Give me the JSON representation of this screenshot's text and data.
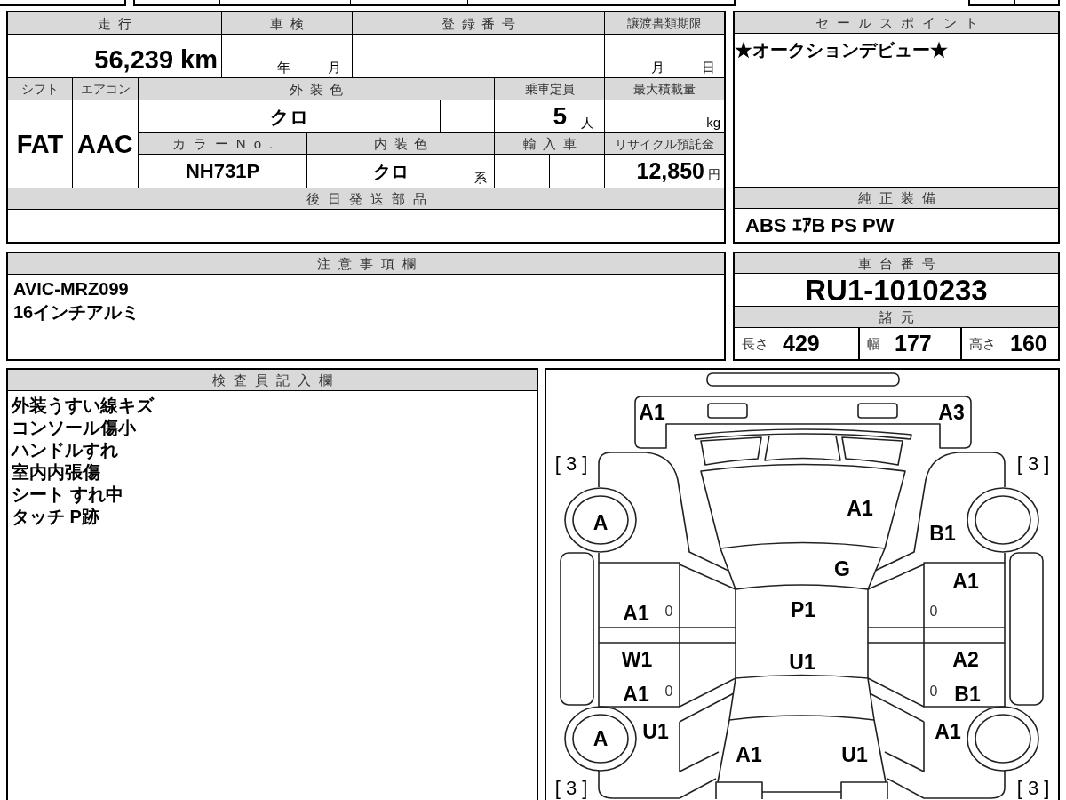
{
  "mileage": {
    "label": "走行",
    "value": "56,239 km"
  },
  "inspection": {
    "label": "車検",
    "year_unit": "年",
    "month_unit": "月"
  },
  "registration_number": {
    "label": "登録番号"
  },
  "transfer_deadline": {
    "label": "譲渡書類期限",
    "month_unit": "月",
    "day_unit": "日"
  },
  "shift": {
    "label": "シフト",
    "value": "FAT"
  },
  "air_conditioner": {
    "label": "エアコン",
    "value": "AAC"
  },
  "exterior_color": {
    "label": "外装色",
    "value": "クロ"
  },
  "seating_capacity": {
    "label": "乗車定員",
    "value": "5",
    "unit": "人"
  },
  "max_load": {
    "label": "最大積載量",
    "unit": "kg"
  },
  "color_number": {
    "label": "カラーNo.",
    "value": "NH731P"
  },
  "interior_color": {
    "label": "内装色",
    "value": "クロ",
    "unit": "系"
  },
  "imported": {
    "label": "輸入車"
  },
  "recycling_deposit": {
    "label": "リサイクル預託金",
    "value": "12,850",
    "unit": "円"
  },
  "later_shipped_parts": {
    "label": "後日発送部品"
  },
  "sales_points": {
    "label": "セールスポイント",
    "text": "★オークションデビュー★"
  },
  "standard_equipment": {
    "label": "純正装備",
    "value": "ABS ｴｱB PS PW"
  },
  "notes": {
    "label": "注意事項欄",
    "lines": [
      "AVIC-MRZ099",
      "16インチアルミ"
    ]
  },
  "chassis_number": {
    "label": "車台番号",
    "value": "RU1-1010233"
  },
  "specifications": {
    "label": "諸元",
    "items": [
      {
        "label": "長さ",
        "value": "429"
      },
      {
        "label": "幅",
        "value": "177"
      },
      {
        "label": "高さ",
        "value": "160"
      }
    ]
  },
  "inspector_notes": {
    "label": "検査員記入欄",
    "lines": [
      "外装うすい線キズ",
      "コンソール傷小",
      "ハンドルすれ",
      "室内内張傷",
      "シート すれ中",
      "タッチ P跡"
    ]
  },
  "condition_diagram": {
    "marks": [
      {
        "text": "A1",
        "kind": "code"
      },
      {
        "text": "A3",
        "kind": "code"
      },
      {
        "text": "[ 3 ]",
        "kind": "bracketed"
      },
      {
        "text": "[ 3 ]",
        "kind": "bracketed"
      },
      {
        "text": "A1",
        "kind": "code"
      },
      {
        "text": "A",
        "kind": "code"
      },
      {
        "text": "B1",
        "kind": "code"
      },
      {
        "text": "G",
        "kind": "code"
      },
      {
        "text": "A1",
        "kind": "code"
      },
      {
        "text": "A1",
        "kind": "code"
      },
      {
        "text": "0",
        "kind": "small"
      },
      {
        "text": "P1",
        "kind": "code"
      },
      {
        "text": "0",
        "kind": "small"
      },
      {
        "text": "W1",
        "kind": "code"
      },
      {
        "text": "U1",
        "kind": "code"
      },
      {
        "text": "A2",
        "kind": "code"
      },
      {
        "text": "A1",
        "kind": "code"
      },
      {
        "text": "0",
        "kind": "small"
      },
      {
        "text": "0",
        "kind": "small"
      },
      {
        "text": "B1",
        "kind": "code"
      },
      {
        "text": "U1",
        "kind": "code"
      },
      {
        "text": "A1",
        "kind": "code"
      },
      {
        "text": "A",
        "kind": "code"
      },
      {
        "text": "A1",
        "kind": "code"
      },
      {
        "text": "U1",
        "kind": "code"
      },
      {
        "text": "[ 3 ]",
        "kind": "bracketed"
      },
      {
        "text": "[ 3 ]",
        "kind": "bracketed"
      }
    ]
  }
}
